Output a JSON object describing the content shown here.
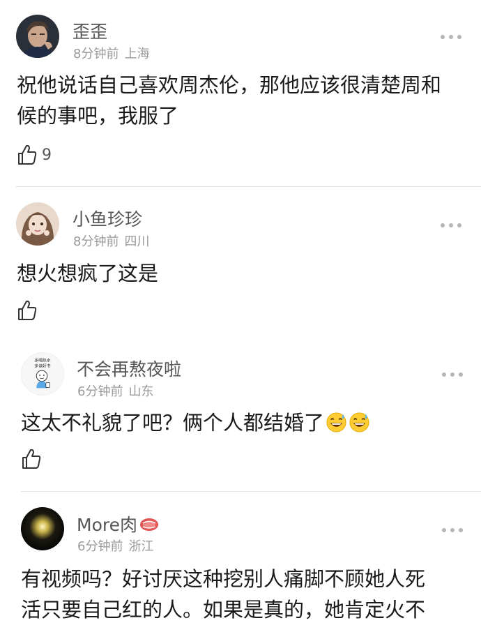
{
  "comments": [
    {
      "username": "歪歪",
      "time": "8分钟前",
      "location": "上海",
      "text": "祝他说话自己喜欢周杰伦，那他应该很清楚周和候的事吧，我服了",
      "like_count": "9",
      "avatar_icon": "man-portrait-avatar"
    },
    {
      "username": "小鱼珍珍",
      "time": "8分钟前",
      "location": "四川",
      "text": "想火想疯了这是",
      "like_count": "",
      "avatar_icon": "girl-portrait-avatar"
    },
    {
      "username": "不会再熬夜啦",
      "time": "6分钟前",
      "location": "山东",
      "text": "这太不礼貌了吧？俩个人都结婚了",
      "like_count": "",
      "avatar_icon": "cartoon-avatar",
      "avatar_caption_1": "多喝热水",
      "avatar_caption_2": "多读好书",
      "emojis": [
        "grinning-sweat-emoji",
        "grinning-sweat-emoji"
      ]
    },
    {
      "username": "More肉",
      "time": "6分钟前",
      "location": "浙江",
      "text_line_1": "有视频吗？好讨厌这种挖别人痛脚不顾她人死",
      "text_line_2": "活只要自己红的人。如果是真的，她肯定火不",
      "like_count": "",
      "avatar_icon": "night-light-avatar",
      "name_icon": "meat-icon"
    }
  ],
  "colors": {
    "username": "#555555",
    "meta": "#9a9a9a",
    "text": "#1a1a1a",
    "divider": "#e6e6e6"
  }
}
